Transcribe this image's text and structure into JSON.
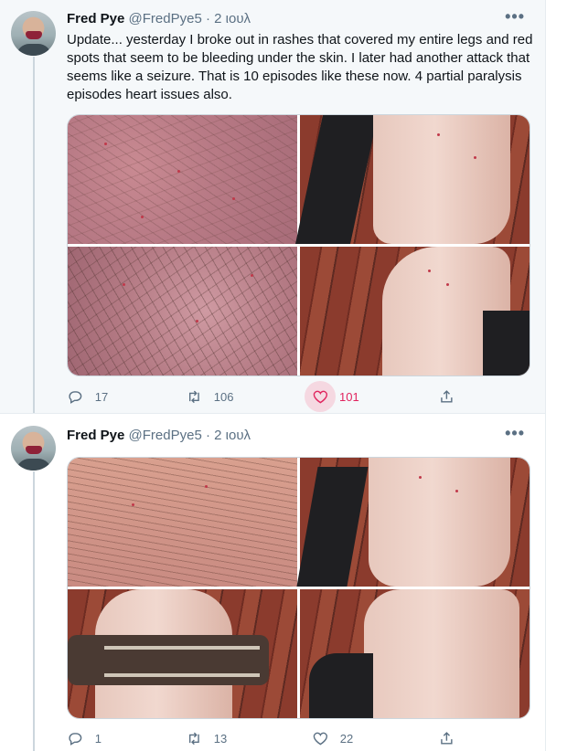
{
  "tweets": [
    {
      "name": "Fred Pye",
      "handle": "@FredPye5",
      "separator": "·",
      "time": "2 ιουλ",
      "text": "Update... yesterday I broke out in rashes that covered my entire legs and red spots that seem to be bleeding under the skin. I later had another attack that seems like a seizure. That is 10 episodes like these now. 4 partial paralysis episodes heart issues also.",
      "replies": "17",
      "retweets": "106",
      "likes": "101",
      "liked": true
    },
    {
      "name": "Fred Pye",
      "handle": "@FredPye5",
      "separator": "·",
      "time": "2 ιουλ",
      "text": "",
      "replies": "1",
      "retweets": "13",
      "likes": "22",
      "liked": false
    }
  ],
  "icons": {
    "more": "more-horizontal-icon",
    "reply": "reply-icon",
    "retweet": "retweet-icon",
    "like": "heart-icon",
    "share": "share-icon"
  },
  "colors": {
    "like_active": "#e0245e",
    "muted": "#5b7083",
    "highlight_bg": "#f5f8fa"
  }
}
